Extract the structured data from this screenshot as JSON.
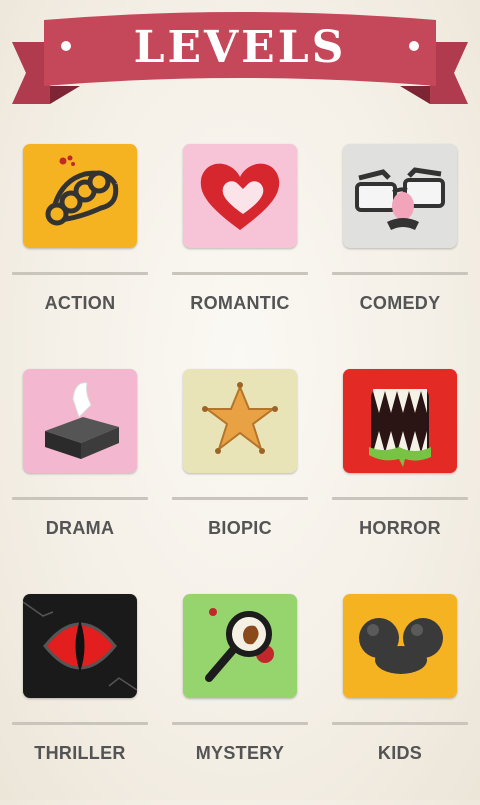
{
  "header": {
    "title": "LEVELS"
  },
  "colors": {
    "banner": "#c5485a",
    "banner_dark": "#9d3043",
    "label_text": "#545454",
    "divider": "#c9c4bc"
  },
  "levels": [
    {
      "label": "ACTION",
      "icon": "brass-knuckles-icon",
      "bg": "#f6b321"
    },
    {
      "label": "ROMANTIC",
      "icon": "heart-icon",
      "bg": "#f6c3d7"
    },
    {
      "label": "COMEDY",
      "icon": "disguise-glasses-icon",
      "bg": "#e0e0de"
    },
    {
      "label": "DRAMA",
      "icon": "tissue-box-icon",
      "bg": "#f3b8cf"
    },
    {
      "label": "BIOPIC",
      "icon": "sheriff-star-icon",
      "bg": "#e8e4b8"
    },
    {
      "label": "HORROR",
      "icon": "monster-mouth-icon",
      "bg": "#e42a24"
    },
    {
      "label": "THRILLER",
      "icon": "cat-eye-icon",
      "bg": "#1a1a1a"
    },
    {
      "label": "MYSTERY",
      "icon": "magnifying-glass-icon",
      "bg": "#96d46d"
    },
    {
      "label": "KIDS",
      "icon": "mouse-ears-icon",
      "bg": "#f6b321"
    }
  ]
}
